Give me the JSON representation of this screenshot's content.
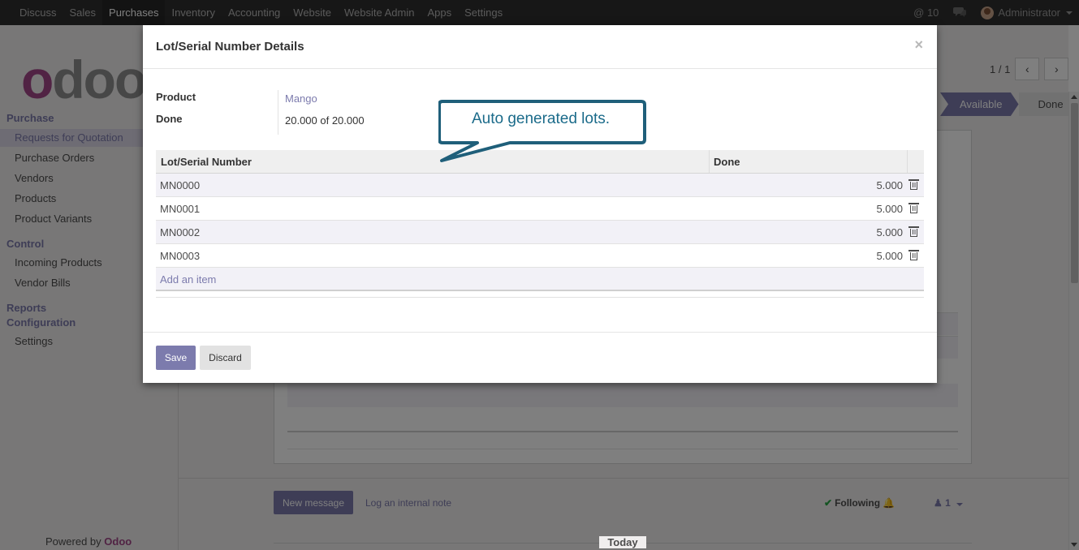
{
  "topnav": {
    "items": [
      "Discuss",
      "Sales",
      "Purchases",
      "Inventory",
      "Accounting",
      "Website",
      "Website Admin",
      "Apps",
      "Settings"
    ],
    "active_index": 2,
    "mentions_count": "10",
    "user_name": "Administrator"
  },
  "logo": {
    "first": "o",
    "rest": "doo"
  },
  "sidebar": {
    "purchase_heading": "Purchase",
    "purchase_items": [
      "Requests for Quotation",
      "Purchase Orders",
      "Vendors",
      "Products",
      "Product Variants"
    ],
    "control_heading": "Control",
    "control_items": [
      "Incoming Products",
      "Vendor Bills"
    ],
    "reports_heading": "Reports",
    "configuration_heading": "Configuration",
    "configuration_items": [
      "Settings"
    ],
    "powered_by": "Powered by",
    "powered_brand": "Odoo"
  },
  "pager": {
    "text": "1 / 1",
    "prev_icon": "chevron-left-icon",
    "next_icon": "chevron-right-icon"
  },
  "statusbar": {
    "available": "Available",
    "done": "Done"
  },
  "chatter": {
    "new_message": "New message",
    "log_note": "Log an internal note",
    "following": "Following",
    "followers_count": "1",
    "today": "Today"
  },
  "modal": {
    "title": "Lot/Serial Number Details",
    "close": "×",
    "product_label": "Product",
    "product_value": "Mango",
    "done_label": "Done",
    "done_value": "20.000 of 20.000",
    "table": {
      "col_lot": "Lot/Serial Number",
      "col_done": "Done",
      "rows": [
        {
          "lot": "MN0000",
          "done": "5.000"
        },
        {
          "lot": "MN0001",
          "done": "5.000"
        },
        {
          "lot": "MN0002",
          "done": "5.000"
        },
        {
          "lot": "MN0003",
          "done": "5.000"
        }
      ],
      "add_item": "Add an item"
    },
    "save": "Save",
    "discard": "Discard"
  },
  "callout": {
    "text": "Auto generated lots."
  },
  "colors": {
    "brand": "#7c7bad",
    "odoo_magenta": "#a24689",
    "topbar": "#2f2f2f",
    "callout_border": "#1f5f7a"
  }
}
